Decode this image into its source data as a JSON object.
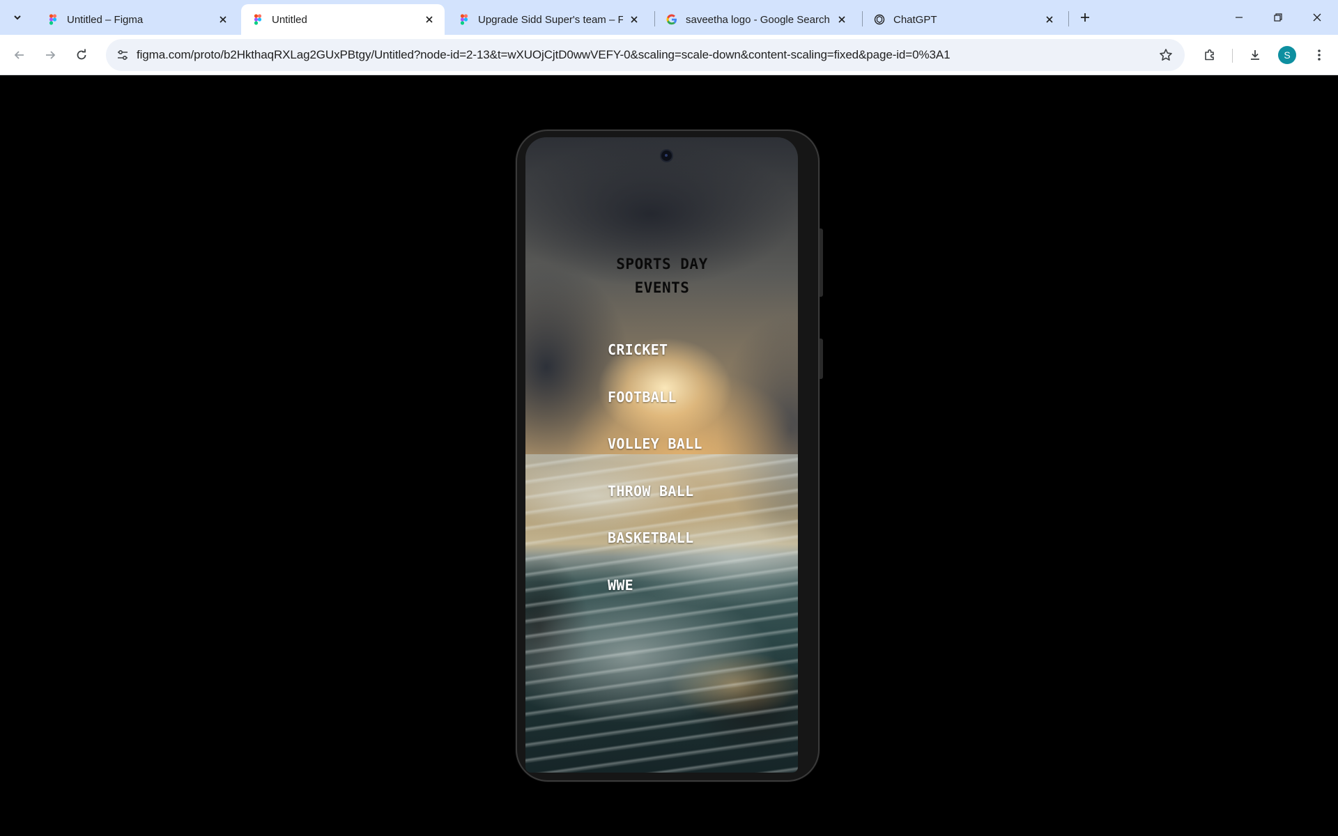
{
  "browser": {
    "tabs": [
      {
        "title": "Untitled – Figma",
        "favicon": "figma-icon",
        "active": false
      },
      {
        "title": "Untitled",
        "favicon": "figma-icon",
        "active": true
      },
      {
        "title": "Upgrade Sidd Super's team – Fi",
        "favicon": "figma-icon",
        "active": false
      },
      {
        "title": "saveetha logo - Google Search",
        "favicon": "google-icon",
        "active": false
      },
      {
        "title": "ChatGPT",
        "favicon": "chatgpt-icon",
        "active": false
      }
    ],
    "url": "figma.com/proto/b2HkthaqRXLag2GUxPBtgy/Untitled?node-id=2-13&t=wXUOjCjtD0wwVEFY-0&scaling=scale-down&content-scaling=fixed&page-id=0%3A1",
    "profile_initial": "S",
    "accent_color": "#d3e3fd",
    "avatar_color": "#0e8fa0"
  },
  "app": {
    "title_line1": "SPORTS DAY",
    "title_line2": "EVENTS",
    "events": [
      "CRICKET",
      "FOOTBALL",
      "VOLLEY BALL",
      "THROW BALL",
      "BASKETBALL",
      "WWE"
    ]
  }
}
